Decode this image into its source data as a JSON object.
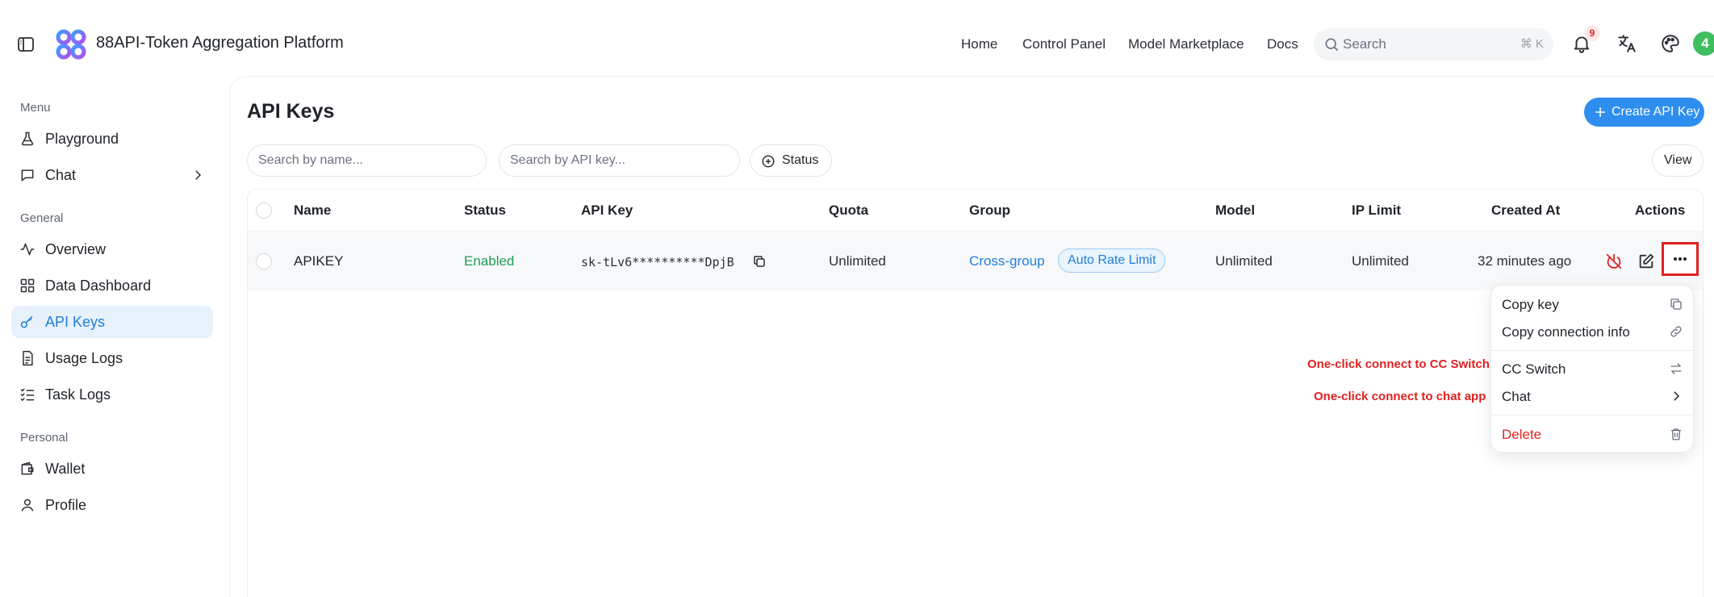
{
  "header": {
    "app_title": "88API-Token Aggregation Platform",
    "nav": [
      "Home",
      "Control Panel",
      "Model Marketplace",
      "Docs"
    ],
    "search": {
      "placeholder": "Search",
      "shortcut": "⌘ K"
    },
    "notification_count": "9",
    "avatar_letter": "4"
  },
  "sidebar": {
    "sections": [
      {
        "label": "Menu",
        "items": [
          {
            "label": "Playground",
            "icon": "flask-icon"
          },
          {
            "label": "Chat",
            "icon": "chat-icon"
          }
        ]
      },
      {
        "label": "General",
        "items": [
          {
            "label": "Overview",
            "icon": "activity-icon"
          },
          {
            "label": "Data Dashboard",
            "icon": "grid-icon"
          },
          {
            "label": "API Keys",
            "icon": "key-icon",
            "active": true
          },
          {
            "label": "Usage Logs",
            "icon": "document-icon"
          },
          {
            "label": "Task Logs",
            "icon": "list-check-icon"
          }
        ]
      },
      {
        "label": "Personal",
        "items": [
          {
            "label": "Wallet",
            "icon": "wallet-icon"
          },
          {
            "label": "Profile",
            "icon": "user-icon"
          }
        ]
      }
    ]
  },
  "main": {
    "title": "API Keys",
    "create_button": "Create API Key",
    "filters": {
      "name_placeholder": "Search by name...",
      "key_placeholder": "Search by API key...",
      "status_label": "Status",
      "view_label": "View"
    },
    "table": {
      "columns": [
        "Name",
        "Status",
        "API Key",
        "Quota",
        "Group",
        "Model",
        "IP Limit",
        "Created At",
        "Actions"
      ],
      "rows": [
        {
          "name": "APIKEY",
          "status": "Enabled",
          "api_key": "sk-tLv6**********DpjB",
          "quota": "Unlimited",
          "group": "Cross-group",
          "group_tag": "Auto Rate Limit",
          "model": "Unlimited",
          "ip_limit": "Unlimited",
          "created_at": "32 minutes ago"
        }
      ]
    },
    "menu": {
      "items": [
        "Copy key",
        "Copy connection info",
        "CC Switch",
        "Chat",
        "Delete"
      ]
    },
    "annotations": [
      "One-click connect to CC Switch",
      "One-click connect to chat app"
    ]
  },
  "colors": {
    "accent": "#2d8ef0",
    "active_bg": "#e6f1fc",
    "success": "#1f9d55",
    "danger": "#e02424",
    "annotation": "#e02020"
  }
}
